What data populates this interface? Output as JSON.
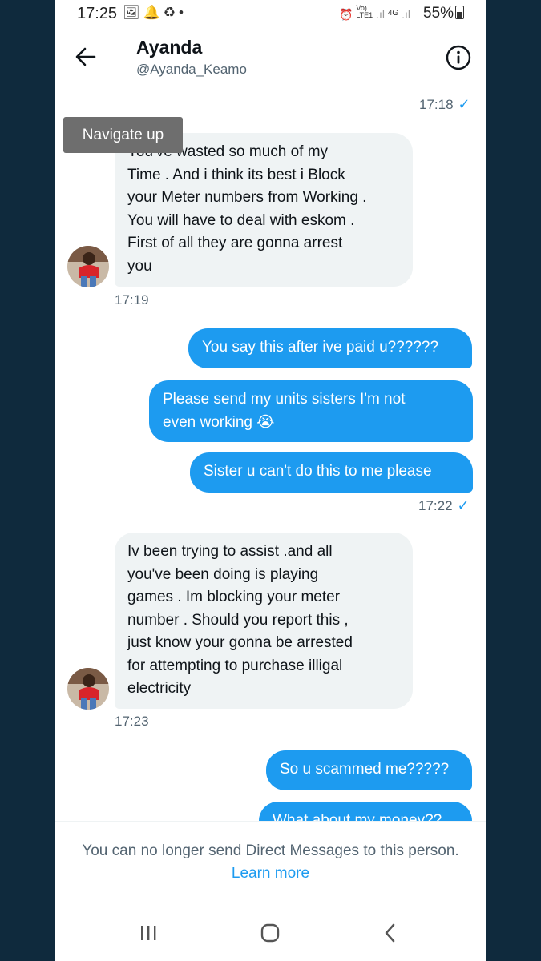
{
  "status_bar": {
    "time": "17:25",
    "left_icons": [
      "gallery-icon",
      "notification-bell-icon",
      "recycle-icon",
      "dot-icon"
    ],
    "right_icons": [
      "alarm-icon",
      "volte-icon",
      "signal-icon",
      "4g-icon",
      "signal-icon"
    ],
    "network_label_1": "Vo)",
    "network_label_2": "LTE1",
    "network_label_3": "4G",
    "battery": "55%"
  },
  "header": {
    "name": "Ayanda",
    "handle": "@Ayanda_Keamo",
    "back_icon": "arrow-left-icon",
    "info_icon": "info-icon"
  },
  "tooltip": "Navigate up",
  "messages": [
    {
      "direction": "out",
      "time": "17:18",
      "read": true
    },
    {
      "direction": "in",
      "lines": [
        "You've wasted so much of my",
        "Time . And i think its best i Block",
        "your Meter numbers from Working .",
        "You will have to deal with eskom .",
        "First of all they are gonna arrest",
        "you"
      ],
      "time": "17:19"
    },
    {
      "direction": "out",
      "lines": [
        "You say this after ive paid u??????"
      ]
    },
    {
      "direction": "out",
      "lines": [
        "Please send my units sisters I'm not",
        "even working 😭"
      ]
    },
    {
      "direction": "out",
      "lines": [
        "Sister u can't do this to me please"
      ],
      "time": "17:22",
      "read": true
    },
    {
      "direction": "in",
      "lines": [
        "Iv been trying to assist .and all",
        "you've been doing is playing",
        "games . Im blocking your meter",
        "number .  Should you report this ,",
        "just know your gonna be arrested",
        "for attempting to purchase illigal",
        "electricity"
      ],
      "time": "17:23"
    },
    {
      "direction": "out",
      "lines": [
        "So u scammed me?????"
      ]
    },
    {
      "direction": "out",
      "lines": [
        "What about my money??"
      ]
    }
  ],
  "footer": {
    "notice": "You can no longer send Direct Messages to this person.",
    "link": "Learn more"
  },
  "nav_bar": [
    "recent-apps-icon",
    "home-icon",
    "back-icon"
  ],
  "colors": {
    "accent": "#1d9bf0",
    "incoming_bubble": "#eff3f4",
    "secondary_text": "#536471",
    "outer_background": "#0f2a3d"
  }
}
